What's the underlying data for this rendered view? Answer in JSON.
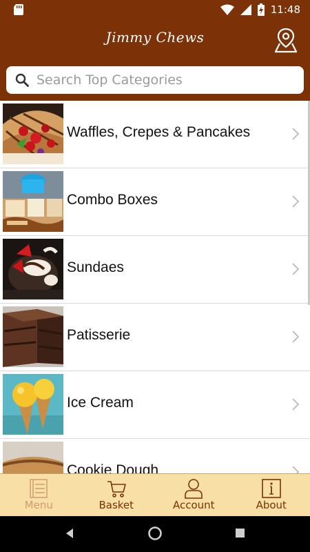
{
  "status_bar": {
    "time": "11:48",
    "icons": [
      "sd-card-icon",
      "wifi-icon",
      "signal-icon",
      "battery-charging-icon"
    ]
  },
  "header": {
    "title": "Jimmy Chews",
    "location_icon": "map-pin-icon"
  },
  "search": {
    "placeholder": "Search Top Categories",
    "value": ""
  },
  "categories": [
    {
      "label": "Waffles, Crepes & Pancakes"
    },
    {
      "label": "Combo Boxes"
    },
    {
      "label": "Sundaes"
    },
    {
      "label": "Patisserie"
    },
    {
      "label": "Ice Cream"
    },
    {
      "label": "Cookie Dough"
    }
  ],
  "tabs": [
    {
      "label": "Menu",
      "icon": "menu-list-icon",
      "active": true
    },
    {
      "label": "Basket",
      "icon": "basket-icon",
      "active": false
    },
    {
      "label": "Account",
      "icon": "account-icon",
      "active": false
    },
    {
      "label": "About",
      "icon": "info-icon",
      "active": false
    }
  ],
  "colors": {
    "brand": "#7a3206",
    "tabbar_bg": "#f8dfa6",
    "tab_active": "#d29a74"
  }
}
